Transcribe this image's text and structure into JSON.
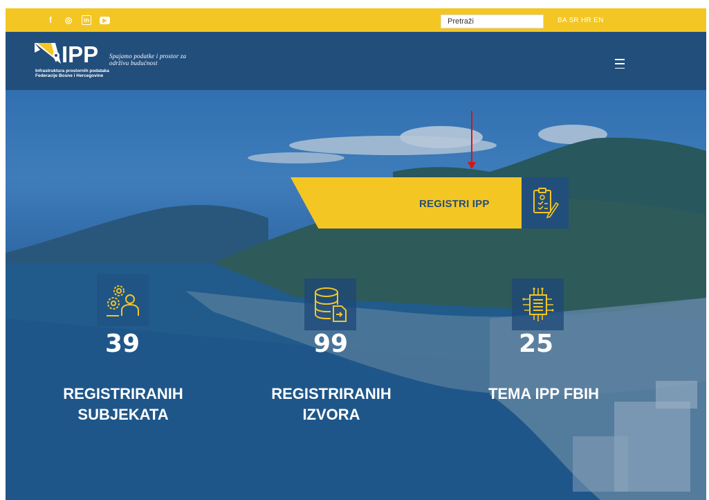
{
  "topbar": {
    "social_icons": [
      "facebook-icon",
      "instagram-icon",
      "linkedin-icon",
      "youtube-icon"
    ],
    "social_glyphs": [
      "f",
      "◎",
      "in",
      "▶"
    ],
    "search_placeholder": "Pretraži",
    "languages": "BA SR HR EN"
  },
  "header": {
    "logo_text": "IPP",
    "logo_subtitle_line1": "Infrastruktura prostornih podataka",
    "logo_subtitle_line2": "Federacije Bosne i Hercegovine",
    "tagline_line1": "Spajamo podatke i prostor za",
    "tagline_line2": "održivu budućnost"
  },
  "hero": {
    "registri_label": "REGISTRI IPP",
    "stats": [
      {
        "number": "39",
        "label": "REGISTRIRANIH\nSUBJEKATA",
        "icon": "gears-person-icon"
      },
      {
        "number": "99",
        "label": "REGISTRIRANIH\nIZVORA",
        "icon": "database-icon"
      },
      {
        "number": "25",
        "label": "TEMA IPP FBIH",
        "icon": "chip-icon"
      }
    ]
  },
  "colors": {
    "accent_yellow": "#f4c624",
    "brand_blue": "#224e7c",
    "annotation_red": "#e01010"
  }
}
